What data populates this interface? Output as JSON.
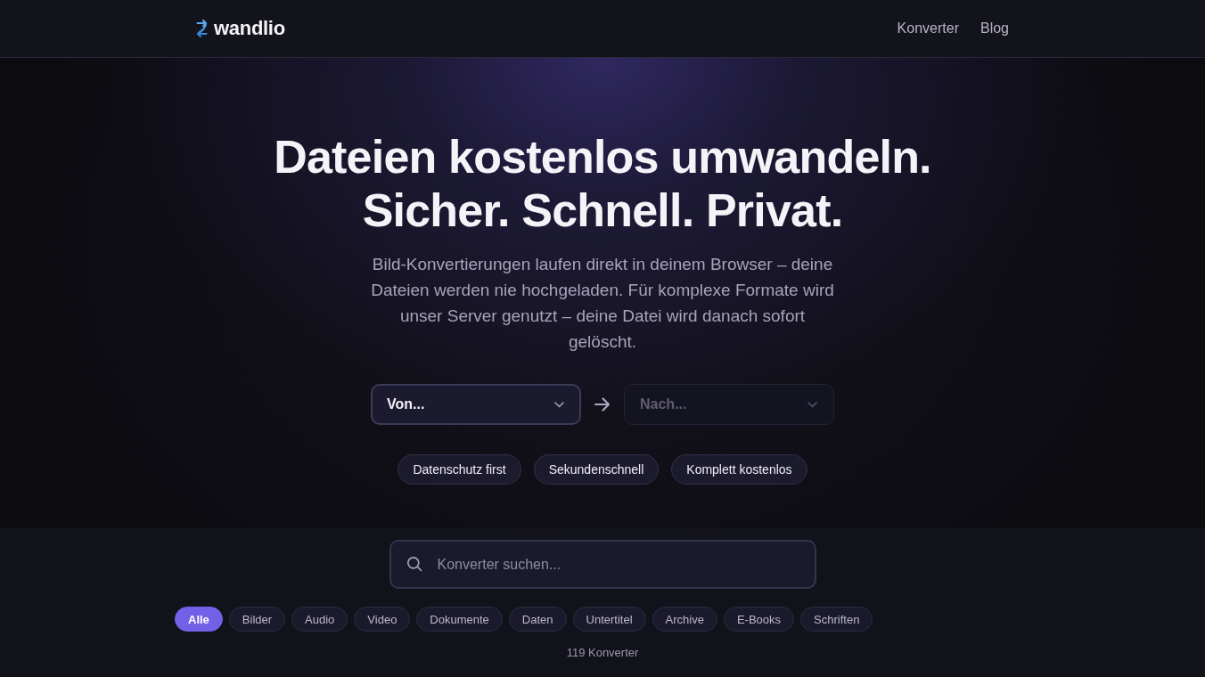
{
  "header": {
    "logo": "wandlio",
    "nav": [
      "Konverter",
      "Blog"
    ]
  },
  "hero": {
    "title_lines": [
      "Dateien kostenlos umwandeln.",
      "Sicher. Schnell. Privat."
    ],
    "subtitle": "Bild-Konvertierungen laufen direkt in deinem Browser – deine Dateien werden nie hochgeladen. Für komplexe Formate wird unser Server genutzt – deine Datei wird danach sofort gelöscht.",
    "from_select": {
      "label": "Von...",
      "disabled": false
    },
    "to_select": {
      "label": "Nach...",
      "disabled": true
    },
    "features": [
      "Datenschutz first",
      "Sekundenschnell",
      "Komplett kostenlos"
    ]
  },
  "search": {
    "placeholder": "Konverter suchen..."
  },
  "categories": [
    {
      "label": "Alle",
      "selected": true
    },
    {
      "label": "Bilder",
      "selected": false
    },
    {
      "label": "Audio",
      "selected": false
    },
    {
      "label": "Video",
      "selected": false
    },
    {
      "label": "Dokumente",
      "selected": false
    },
    {
      "label": "Daten",
      "selected": false
    },
    {
      "label": "Untertitel",
      "selected": false
    },
    {
      "label": "Archive",
      "selected": false
    },
    {
      "label": "E-Books",
      "selected": false
    },
    {
      "label": "Schriften",
      "selected": false
    }
  ],
  "count": "119 Konverter"
}
